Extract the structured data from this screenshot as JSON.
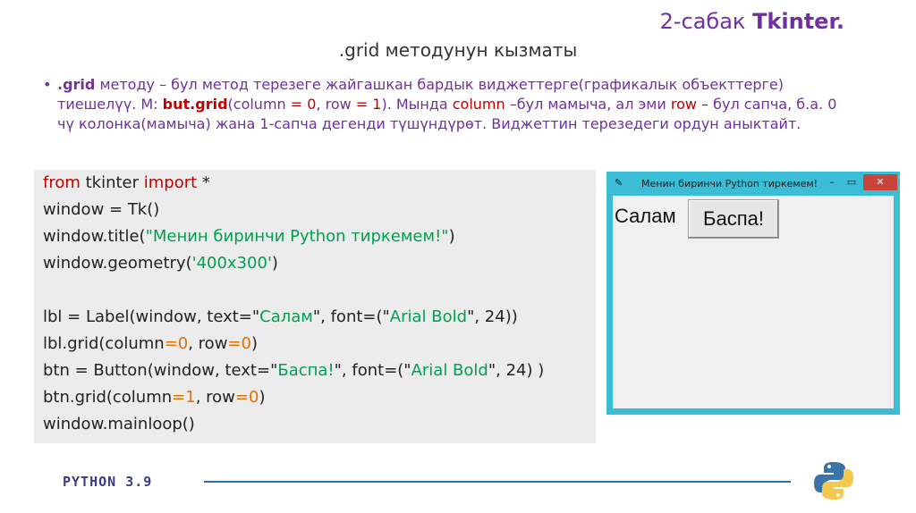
{
  "header": {
    "lesson_prefix": "2-сабак ",
    "lesson_topic": "Tkinter.",
    "subtitle": ".grid методунун кызматы"
  },
  "bullet": {
    "marker": "•",
    "t1": ".grid",
    "t2": " методу – бул метод терезеге жайгашкан бардык виджеттерге(графикалык объекттерге) тиешелүү. М: ",
    "t3": "but.grid",
    "t4": "(column ",
    "t5": "= 0",
    "t6": ", row ",
    "t7": "= 1",
    "t8": "). Мында ",
    "t9": "column",
    "t10": " –бул мамыча, ал эми ",
    "t11": "row –",
    "t12": " бул сапча, б.а. 0 чү колонка(мамыча) жана 1-сапча дегенди түшүндүрөт. Виджеттин терезедеги ордун аныктайт."
  },
  "code": {
    "l1": {
      "a": "from",
      "b": " tkinter ",
      "c": "import",
      "d": " *"
    },
    "l2": "window = Tk()",
    "l3": {
      "a": "window.title(",
      "b": "\"Менин биринчи Python тиркемем!\"",
      "c": ")"
    },
    "l4": {
      "a": "window.geometry(",
      "b": "'400x300'",
      "c": ")"
    },
    "l5": {
      "a": "lbl = Label(window, text=\"",
      "b": "Салам",
      "c": "\", font=(\"",
      "d": "Arial Bold",
      "e": "\", 24))"
    },
    "l6": {
      "a": "lbl.grid(column",
      "b": "=0",
      "c": ", row",
      "d": "=0",
      "e": ")"
    },
    "l7": {
      "a": "btn = Button(window, text=\"",
      "b": "Баспа!",
      "c": "\", font=(\"",
      "d": "Arial Bold",
      "e": "\", 24) )"
    },
    "l8": {
      "a": "btn.grid(column",
      "b": "=1",
      "c": ", row",
      "d": "=0",
      "e": ")"
    },
    "l9": "window.mainloop()"
  },
  "window": {
    "feather": "✎",
    "title": "Менин биринчи Python тиркемем!",
    "minimize": "–",
    "maximize": "▭",
    "close": "✕",
    "label_text": "Салам",
    "button_text": "Баспа!"
  },
  "footer": {
    "logo_text": "PYTHON 3.9"
  },
  "colors": {
    "purple": "#7030a0",
    "red": "#c00000",
    "green": "#00a050",
    "orange": "#e07000",
    "window_border": "#3bbdd5"
  }
}
